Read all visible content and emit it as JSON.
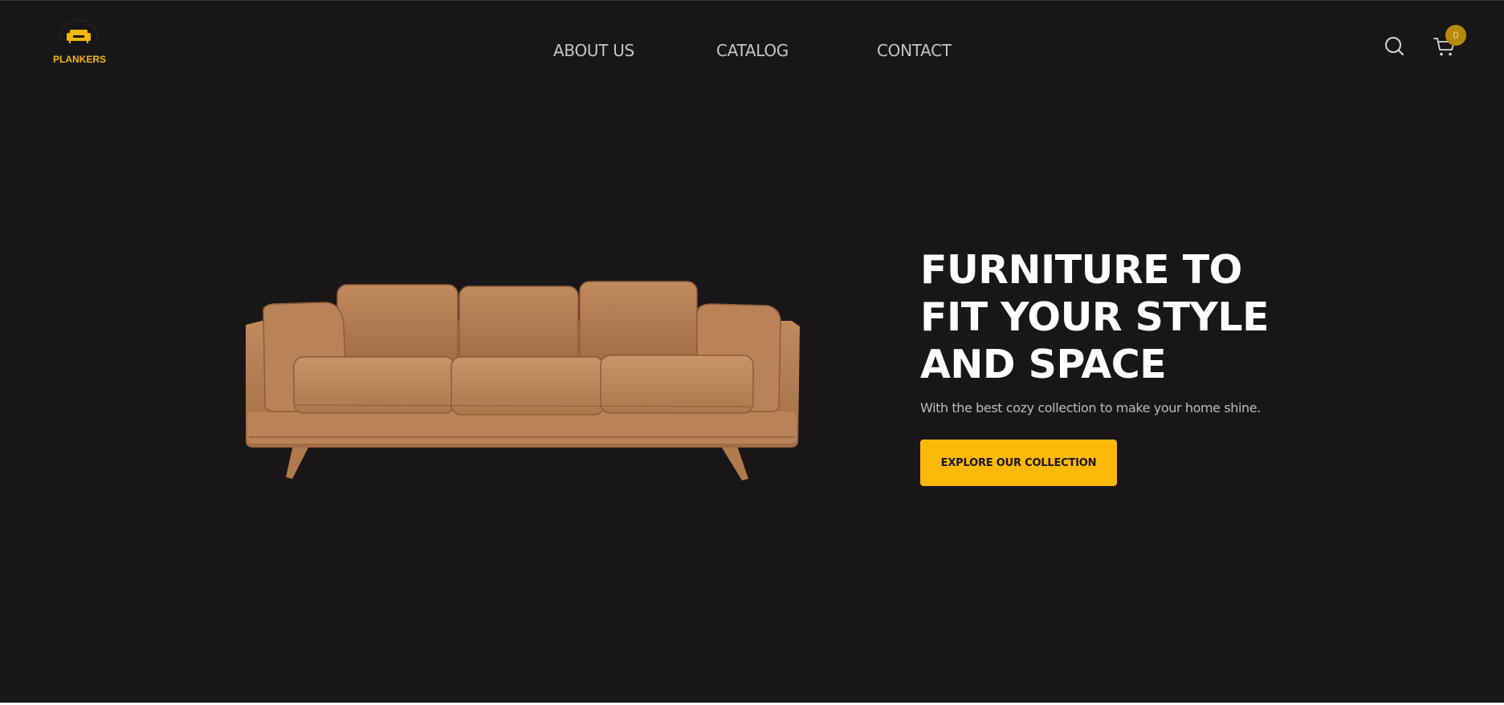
{
  "brand": {
    "name": "PLANKERS",
    "logo_icon": "sofa-icon",
    "accent_color": "#f2b705"
  },
  "nav": {
    "items": [
      {
        "label": "ABOUT US"
      },
      {
        "label": "CATALOG"
      },
      {
        "label": "CONTACT"
      }
    ]
  },
  "header_actions": {
    "search_icon": "search-icon",
    "cart_icon": "cart-icon",
    "cart_count": "0"
  },
  "hero": {
    "title_lines": [
      "FURNITURE TO",
      "FIT YOUR STYLE",
      "AND SPACE"
    ],
    "subtitle": "With the best cozy collection to make your home shine.",
    "cta_label": "EXPLORE OUR COLLECTION",
    "image": "leather-sofa"
  },
  "colors": {
    "background": "#191618",
    "button": "#fcb908",
    "badge": "#b88a07",
    "nav_text": "#c7c4c4"
  }
}
